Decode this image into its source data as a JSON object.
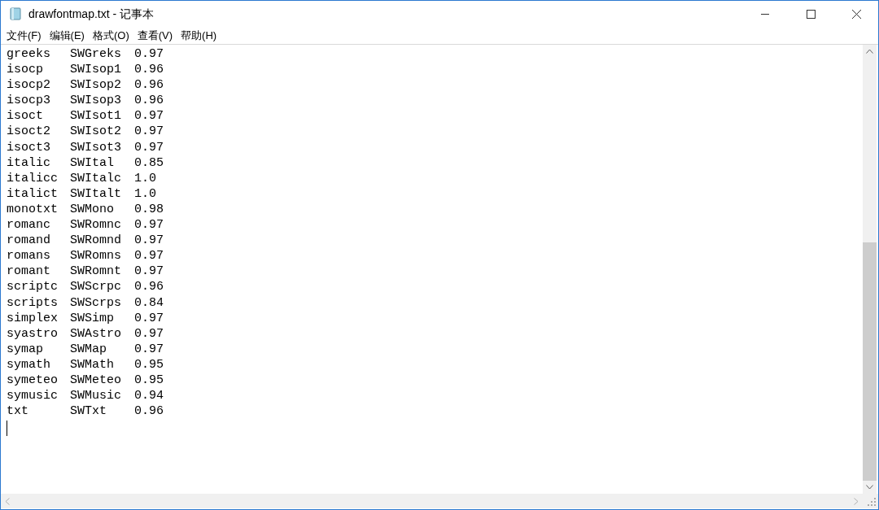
{
  "window": {
    "title": "drawfontmap.txt - 记事本"
  },
  "menu": [
    "文件(F)",
    "编辑(E)",
    "格式(O)",
    "查看(V)",
    "帮助(H)"
  ],
  "lines": [
    [
      "greeks",
      "SWGreks",
      "0.97"
    ],
    [
      "isocp",
      "SWIsop1",
      "0.96"
    ],
    [
      "isocp2",
      "SWIsop2",
      "0.96"
    ],
    [
      "isocp3",
      "SWIsop3",
      "0.96"
    ],
    [
      "isoct",
      "SWIsot1",
      "0.97"
    ],
    [
      "isoct2",
      "SWIsot2",
      "0.97"
    ],
    [
      "isoct3",
      "SWIsot3",
      "0.97"
    ],
    [
      "italic",
      "SWItal",
      "0.85"
    ],
    [
      "italicc",
      "SWItalc",
      "1.0"
    ],
    [
      "italict",
      "SWItalt",
      "1.0"
    ],
    [
      "monotxt",
      "SWMono",
      "0.98"
    ],
    [
      "romanc",
      "SWRomnc",
      "0.97"
    ],
    [
      "romand",
      "SWRomnd",
      "0.97"
    ],
    [
      "romans",
      "SWRomns",
      "0.97"
    ],
    [
      "romant",
      "SWRomnt",
      "0.97"
    ],
    [
      "scriptc",
      "SWScrpc",
      "0.96"
    ],
    [
      "scripts",
      "SWScrps",
      "0.84"
    ],
    [
      "simplex",
      "SWSimp",
      "0.97"
    ],
    [
      "syastro",
      "SWAstro",
      "0.97"
    ],
    [
      "symap",
      "SWMap",
      "0.97"
    ],
    [
      "symath",
      "SWMath",
      "0.95"
    ],
    [
      "symeteo",
      "SWMeteo",
      "0.95"
    ],
    [
      "symusic",
      "SWMusic",
      "0.94"
    ],
    [
      "txt",
      "SWTxt",
      "0.96"
    ]
  ]
}
